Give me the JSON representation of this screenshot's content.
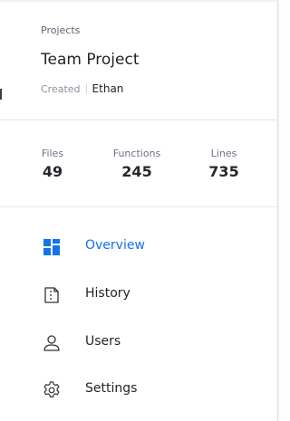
{
  "header": {
    "breadcrumb": "Projects",
    "title": "Team Project",
    "created_label": "Created",
    "created_by": "Ethan"
  },
  "stats": [
    {
      "label": "Files",
      "value": "49"
    },
    {
      "label": "Functions",
      "value": "245"
    },
    {
      "label": "Lines",
      "value": "735"
    }
  ],
  "nav": {
    "items": [
      {
        "label": "Overview",
        "icon": "dashboard-icon",
        "active": true
      },
      {
        "label": "History",
        "icon": "history-icon",
        "active": false
      },
      {
        "label": "Users",
        "icon": "user-icon",
        "active": false
      },
      {
        "label": "Settings",
        "icon": "gear-icon",
        "active": false
      }
    ]
  },
  "colors": {
    "accent": "#1273eb",
    "text": "#1f2328",
    "muted": "#5d6472",
    "divider": "#e3e6ea"
  }
}
